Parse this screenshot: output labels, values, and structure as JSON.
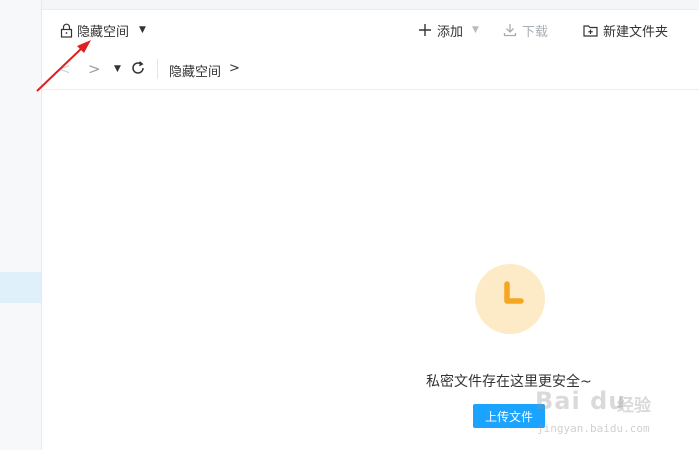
{
  "toolbar": {
    "space_label": "隐藏空间",
    "add_label": "添加",
    "download_label": "下载",
    "new_folder_label": "新建文件夹"
  },
  "navbar": {
    "breadcrumb": "隐藏空间",
    "breadcrumb_sep": ">"
  },
  "empty_state": {
    "message": "私密文件存在这里更安全~",
    "upload_label": "上传文件"
  },
  "watermark": {
    "logo": "Bai du",
    "text": "经验",
    "url": "jingyan.baidu.com"
  },
  "colors": {
    "accent": "#1aa3ff",
    "annotation_arrow": "#e02020",
    "clock_bg": "#fdebc8",
    "clock_hands": "#f5a623"
  }
}
